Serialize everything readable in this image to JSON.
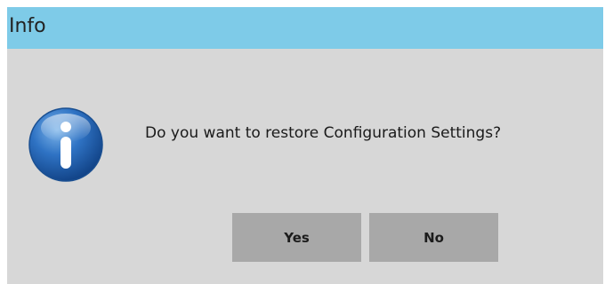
{
  "window": {
    "title": "Info"
  },
  "message": {
    "text": "Do you want to restore Configuration Settings?",
    "icon": "info-icon"
  },
  "buttons": {
    "yes_label": "Yes",
    "no_label": "No"
  },
  "colors": {
    "titlebar": "#7ecbe8",
    "background": "#d7d7d7",
    "button": "#a8a8a8",
    "icon_blue": "#1e5fa8"
  }
}
